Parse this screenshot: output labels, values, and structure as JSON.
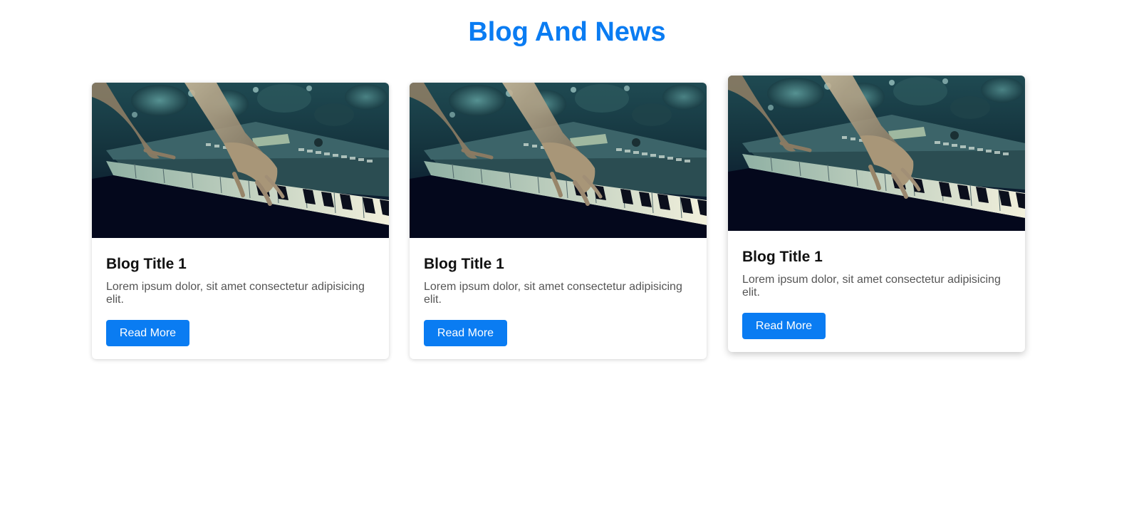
{
  "section": {
    "title": "Blog And News",
    "title_color": "#0a7cf2"
  },
  "colors": {
    "button_bg": "#0a7cf2",
    "button_text": "#ffffff",
    "body_text": "#555555",
    "title_text": "#111111"
  },
  "cards": [
    {
      "image": "keyboard-piano-photo",
      "title": "Blog Title 1",
      "text": "Lorem ipsum dolor, sit amet consectetur adipisicing elit.",
      "button_label": "Read More"
    },
    {
      "image": "keyboard-piano-photo",
      "title": "Blog Title 1",
      "text": "Lorem ipsum dolor, sit amet consectetur adipisicing elit.",
      "button_label": "Read More"
    },
    {
      "image": "keyboard-piano-photo",
      "title": "Blog Title 1",
      "text": "Lorem ipsum dolor, sit amet consectetur adipisicing elit.",
      "button_label": "Read More"
    }
  ]
}
